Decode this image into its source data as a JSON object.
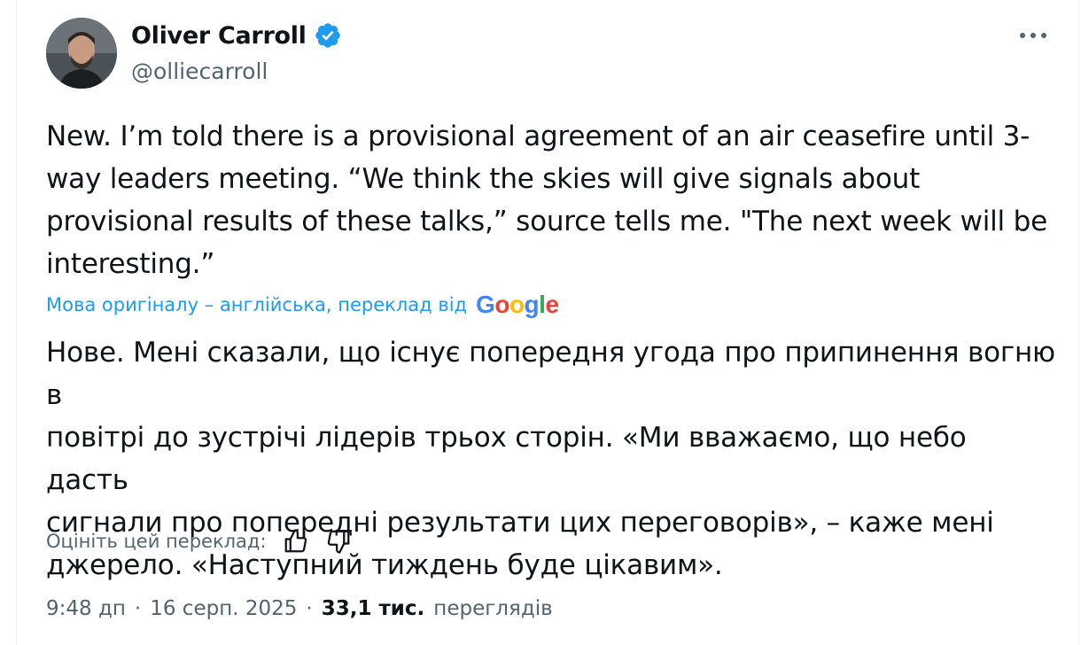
{
  "author": {
    "name": "Oliver Carroll",
    "handle": "@olliecarroll",
    "verified_color": "#1d9bf0"
  },
  "tweet": {
    "text": "New. I’m told there is a provisional agreement of an air ceasefire until 3-\nway leaders meeting. “We think the skies will give signals about\nprovisional results of these talks,” source tells me. \"The next week will be\ninteresting.”",
    "translation_note": "Мова оригіналу – англійська, переклад від",
    "translation_provider": "Google",
    "translated_text": "Нове. Мені сказали, що існує попередня угода про припинення вогню в\nповітрі до зустрічі лідерів трьох сторін. «Ми вважаємо, що небо дасть\nсигнали про попередні результати цих переговорів», – каже мені\nджерело. «Наступний тиждень буде цікавим».",
    "rate_label": "Оцініть цей переклад:",
    "time": "9:48 дп",
    "date": "16 серп. 2025",
    "views_count": "33,1 тис.",
    "views_label": "переглядів",
    "separator": "·"
  },
  "icons": {
    "more": "more-icon",
    "thumbs_up": "thumbs-up-icon",
    "thumbs_down": "thumbs-down-icon",
    "verified": "verified-badge-icon"
  },
  "colors": {
    "accent": "#1d9bf0",
    "text": "#0f1419",
    "secondary": "#536471"
  }
}
